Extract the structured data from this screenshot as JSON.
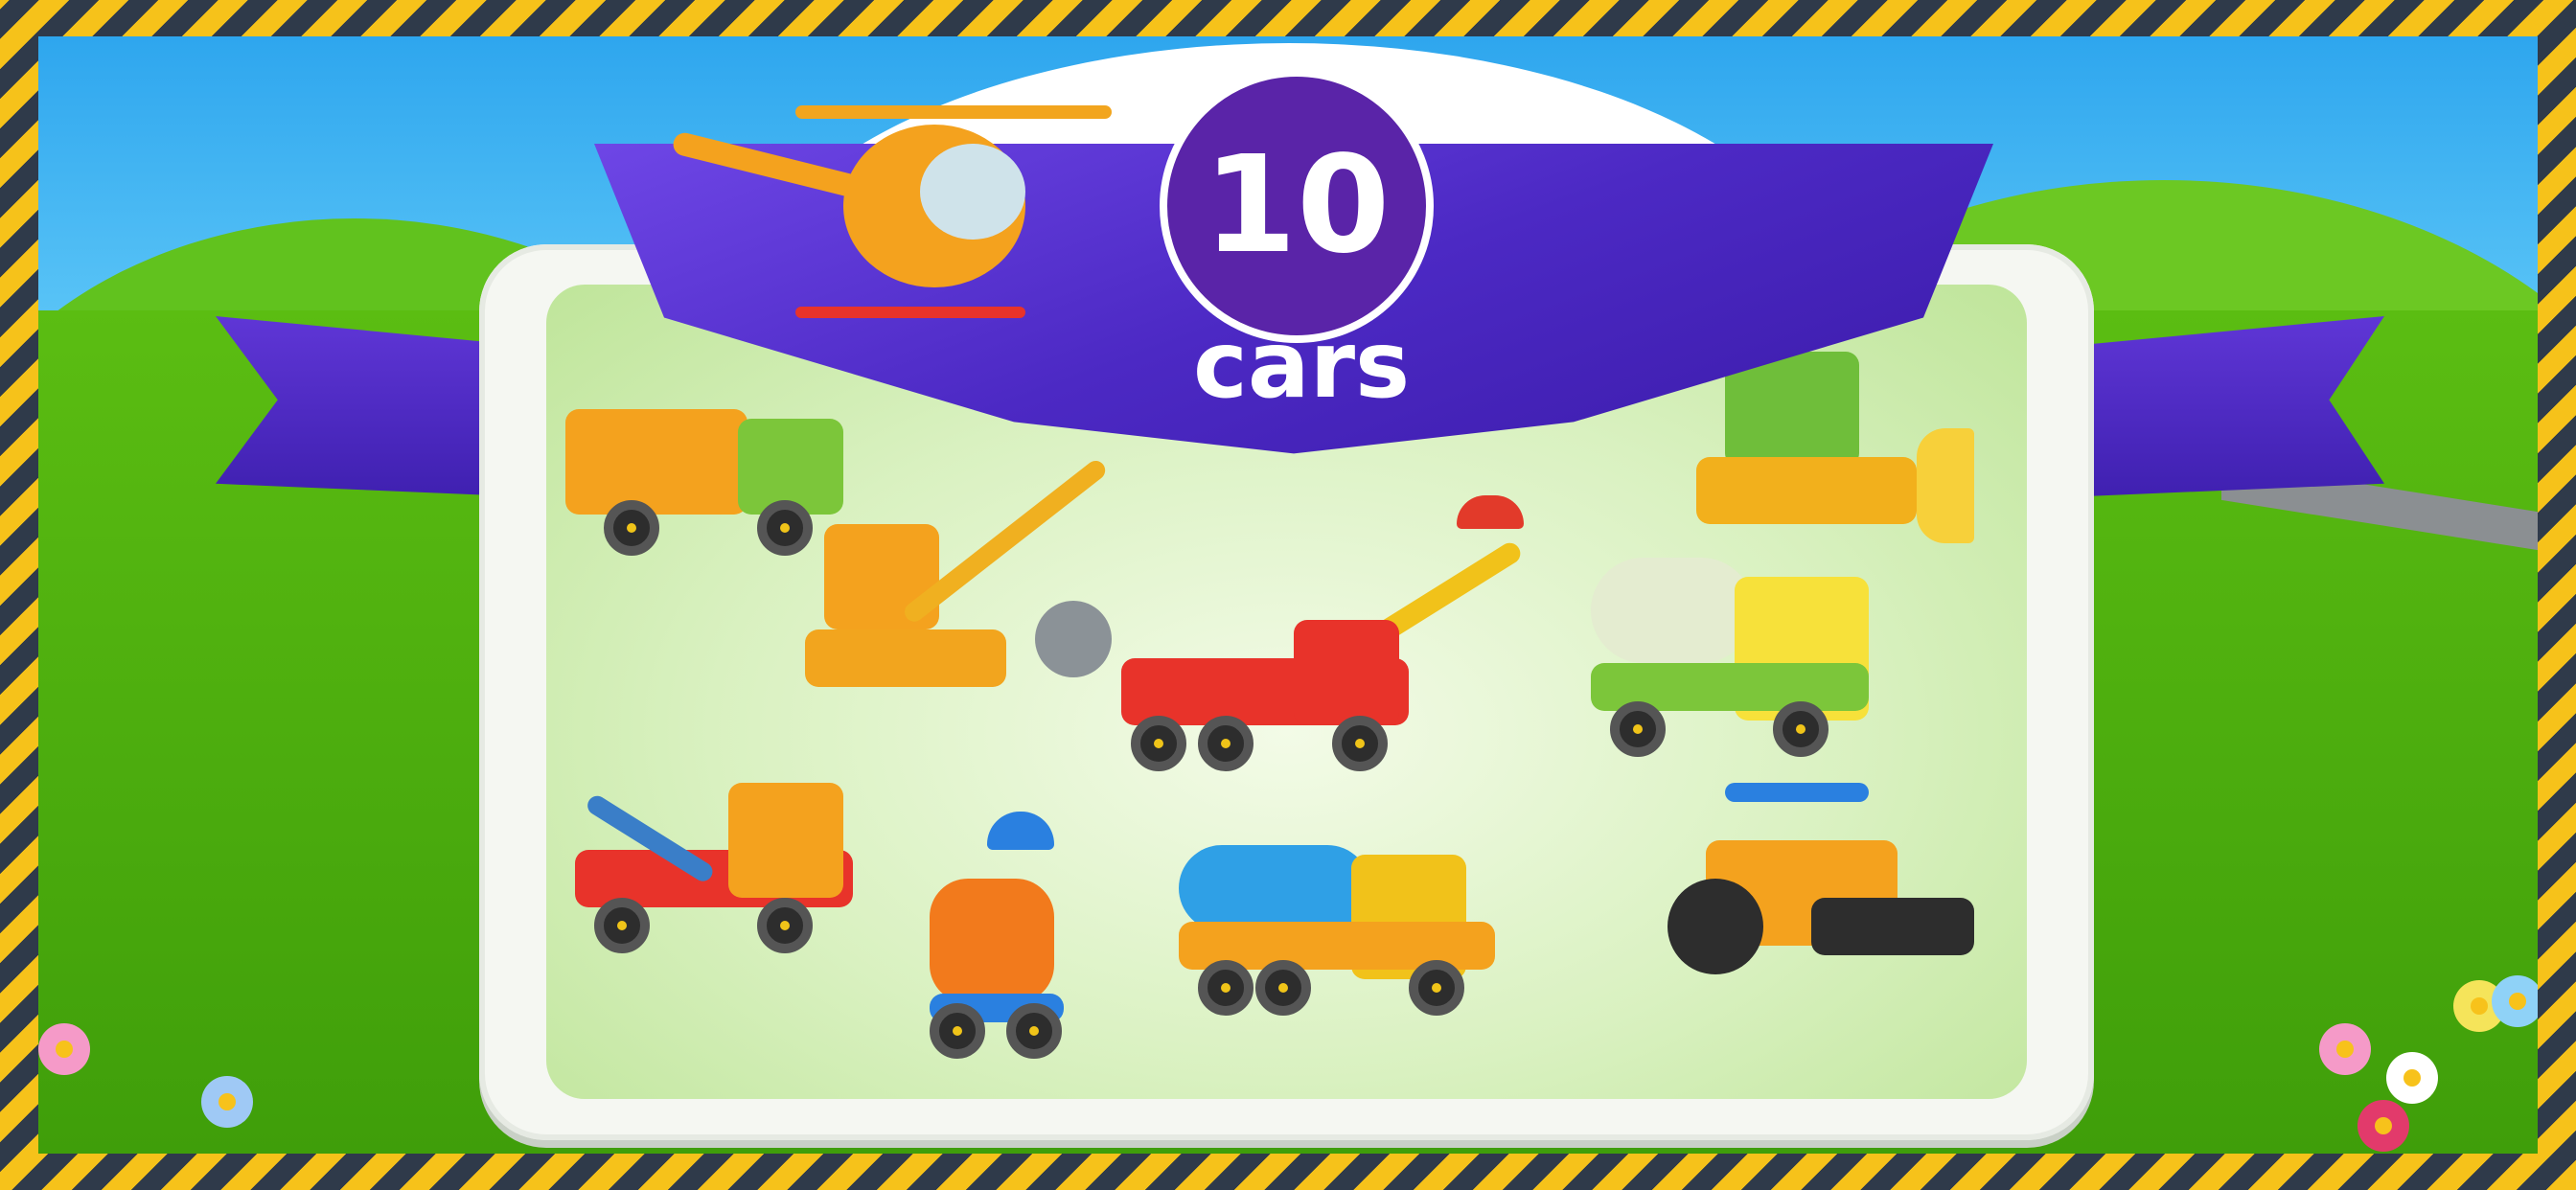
{
  "promo": {
    "count": "10",
    "label": "cars"
  },
  "colors": {
    "ribbon": "#4c29c4",
    "badge": "#5a24a8",
    "border_stripe_yellow": "#f6c21a",
    "border_stripe_dark": "#2f3a4a",
    "grass": "#5bbd12",
    "sky": "#2ea6ee"
  },
  "vehicles": [
    "garbage-truck",
    "bulldozer",
    "crawler-crane",
    "mobile-crane",
    "cement-mixer",
    "tow-truck",
    "excavator",
    "tanker-truck",
    "road-roller",
    "helicopter"
  ]
}
